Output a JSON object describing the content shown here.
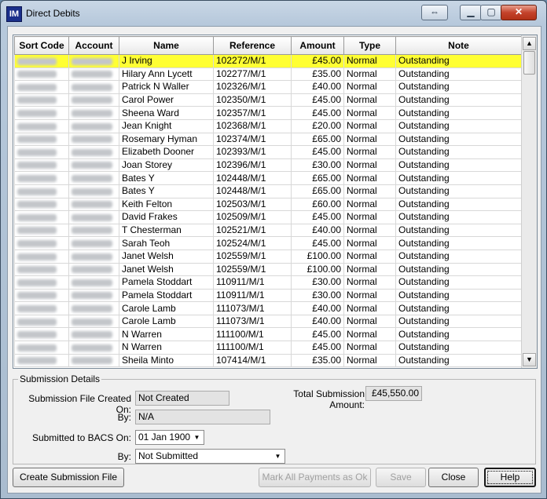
{
  "window": {
    "title": "Direct Debits",
    "app_icon": "IM"
  },
  "columns": [
    "Sort Code",
    "Account",
    "Name",
    "Reference",
    "Amount",
    "Type",
    "Note"
  ],
  "rows": [
    {
      "name": "J Irving",
      "reference": "102272/M/1",
      "amount": "£45.00",
      "type": "Normal",
      "note": "Outstanding",
      "selected": true
    },
    {
      "name": "Hilary Ann Lycett",
      "reference": "102277/M/1",
      "amount": "£35.00",
      "type": "Normal",
      "note": "Outstanding"
    },
    {
      "name": "Patrick N Waller",
      "reference": "102326/M/1",
      "amount": "£40.00",
      "type": "Normal",
      "note": "Outstanding"
    },
    {
      "name": "Carol Power",
      "reference": "102350/M/1",
      "amount": "£45.00",
      "type": "Normal",
      "note": "Outstanding"
    },
    {
      "name": "Sheena Ward",
      "reference": "102357/M/1",
      "amount": "£45.00",
      "type": "Normal",
      "note": "Outstanding"
    },
    {
      "name": "Jean Knight",
      "reference": "102368/M/1",
      "amount": "£20.00",
      "type": "Normal",
      "note": "Outstanding"
    },
    {
      "name": "Rosemary Hyman",
      "reference": "102374/M/1",
      "amount": "£65.00",
      "type": "Normal",
      "note": "Outstanding"
    },
    {
      "name": "Elizabeth Dooner",
      "reference": "102393/M/1",
      "amount": "£45.00",
      "type": "Normal",
      "note": "Outstanding"
    },
    {
      "name": "Joan Storey",
      "reference": "102396/M/1",
      "amount": "£30.00",
      "type": "Normal",
      "note": "Outstanding"
    },
    {
      "name": "Bates Y",
      "reference": "102448/M/1",
      "amount": "£65.00",
      "type": "Normal",
      "note": "Outstanding"
    },
    {
      "name": "Bates Y",
      "reference": "102448/M/1",
      "amount": "£65.00",
      "type": "Normal",
      "note": "Outstanding"
    },
    {
      "name": "Keith Felton",
      "reference": "102503/M/1",
      "amount": "£60.00",
      "type": "Normal",
      "note": "Outstanding"
    },
    {
      "name": "David Frakes",
      "reference": "102509/M/1",
      "amount": "£45.00",
      "type": "Normal",
      "note": "Outstanding"
    },
    {
      "name": "T Chesterman",
      "reference": "102521/M/1",
      "amount": "£40.00",
      "type": "Normal",
      "note": "Outstanding"
    },
    {
      "name": "Sarah Teoh",
      "reference": "102524/M/1",
      "amount": "£45.00",
      "type": "Normal",
      "note": "Outstanding"
    },
    {
      "name": "Janet Welsh",
      "reference": "102559/M/1",
      "amount": "£100.00",
      "type": "Normal",
      "note": "Outstanding"
    },
    {
      "name": "Janet Welsh",
      "reference": "102559/M/1",
      "amount": "£100.00",
      "type": "Normal",
      "note": "Outstanding"
    },
    {
      "name": "Pamela Stoddart",
      "reference": "110911/M/1",
      "amount": "£30.00",
      "type": "Normal",
      "note": "Outstanding"
    },
    {
      "name": "Pamela Stoddart",
      "reference": "110911/M/1",
      "amount": "£30.00",
      "type": "Normal",
      "note": "Outstanding"
    },
    {
      "name": "Carole Lamb",
      "reference": "111073/M/1",
      "amount": "£40.00",
      "type": "Normal",
      "note": "Outstanding"
    },
    {
      "name": "Carole Lamb",
      "reference": "111073/M/1",
      "amount": "£40.00",
      "type": "Normal",
      "note": "Outstanding"
    },
    {
      "name": "N Warren",
      "reference": "111100/M/1",
      "amount": "£45.00",
      "type": "Normal",
      "note": "Outstanding"
    },
    {
      "name": "N Warren",
      "reference": "111100/M/1",
      "amount": "£45.00",
      "type": "Normal",
      "note": "Outstanding"
    },
    {
      "name": "Sheila Minto",
      "reference": "107414/M/1",
      "amount": "£35.00",
      "type": "Normal",
      "note": "Outstanding"
    }
  ],
  "details": {
    "legend": "Submission Details",
    "file_created_label": "Submission File Created On:",
    "file_created_value": "Not Created",
    "by_label": "By:",
    "by_value": "N/A",
    "total_label": "Total Submission Amount:",
    "total_value": "£45,550.00",
    "submitted_label": "Submitted to BACS On:",
    "submitted_value": "01 Jan 1900",
    "submitted_by_label": "By:",
    "submitted_by_value": "Not Submitted"
  },
  "buttons": {
    "create": "Create Submission File",
    "mark_all": "Mark All Payments as Ok",
    "save": "Save",
    "close": "Close",
    "help": "Help"
  },
  "colors": {
    "selected_row": "#ffff33",
    "close_button": "#c4432b"
  }
}
